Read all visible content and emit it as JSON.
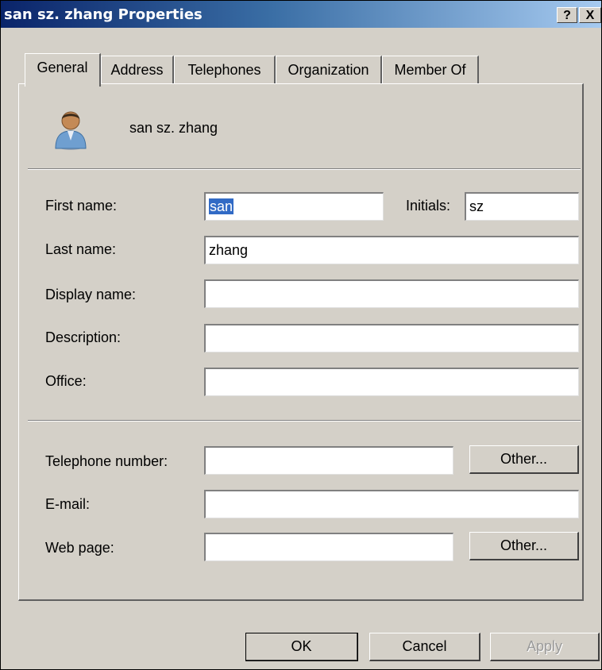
{
  "window": {
    "title": "san sz. zhang Properties",
    "help_label": "?",
    "close_label": "X"
  },
  "tabs": [
    {
      "label": "General",
      "active": true
    },
    {
      "label": "Address"
    },
    {
      "label": "Telephones"
    },
    {
      "label": "Organization"
    },
    {
      "label": "Member Of"
    }
  ],
  "header": {
    "display_name": "san sz. zhang",
    "icon": "user-icon"
  },
  "form": {
    "first_name": {
      "label": "First name:",
      "value": "san"
    },
    "initials": {
      "label": "Initials:",
      "value": "sz"
    },
    "last_name": {
      "label": "Last name:",
      "value": "zhang"
    },
    "display_name": {
      "label": "Display name:",
      "value": ""
    },
    "description": {
      "label": "Description:",
      "value": ""
    },
    "office": {
      "label": "Office:",
      "value": ""
    },
    "telephone": {
      "label": "Telephone number:",
      "value": "",
      "other_label": "Other..."
    },
    "email": {
      "label": "E-mail:",
      "value": ""
    },
    "web_page": {
      "label": "Web page:",
      "value": "",
      "other_label": "Other..."
    }
  },
  "buttons": {
    "ok": "OK",
    "cancel": "Cancel",
    "apply": "Apply"
  },
  "colors": {
    "title_gradient_start": "#0a246a",
    "title_gradient_end": "#a6caf0",
    "dialog_bg": "#d4d0c8",
    "selection": "#316ac5"
  }
}
